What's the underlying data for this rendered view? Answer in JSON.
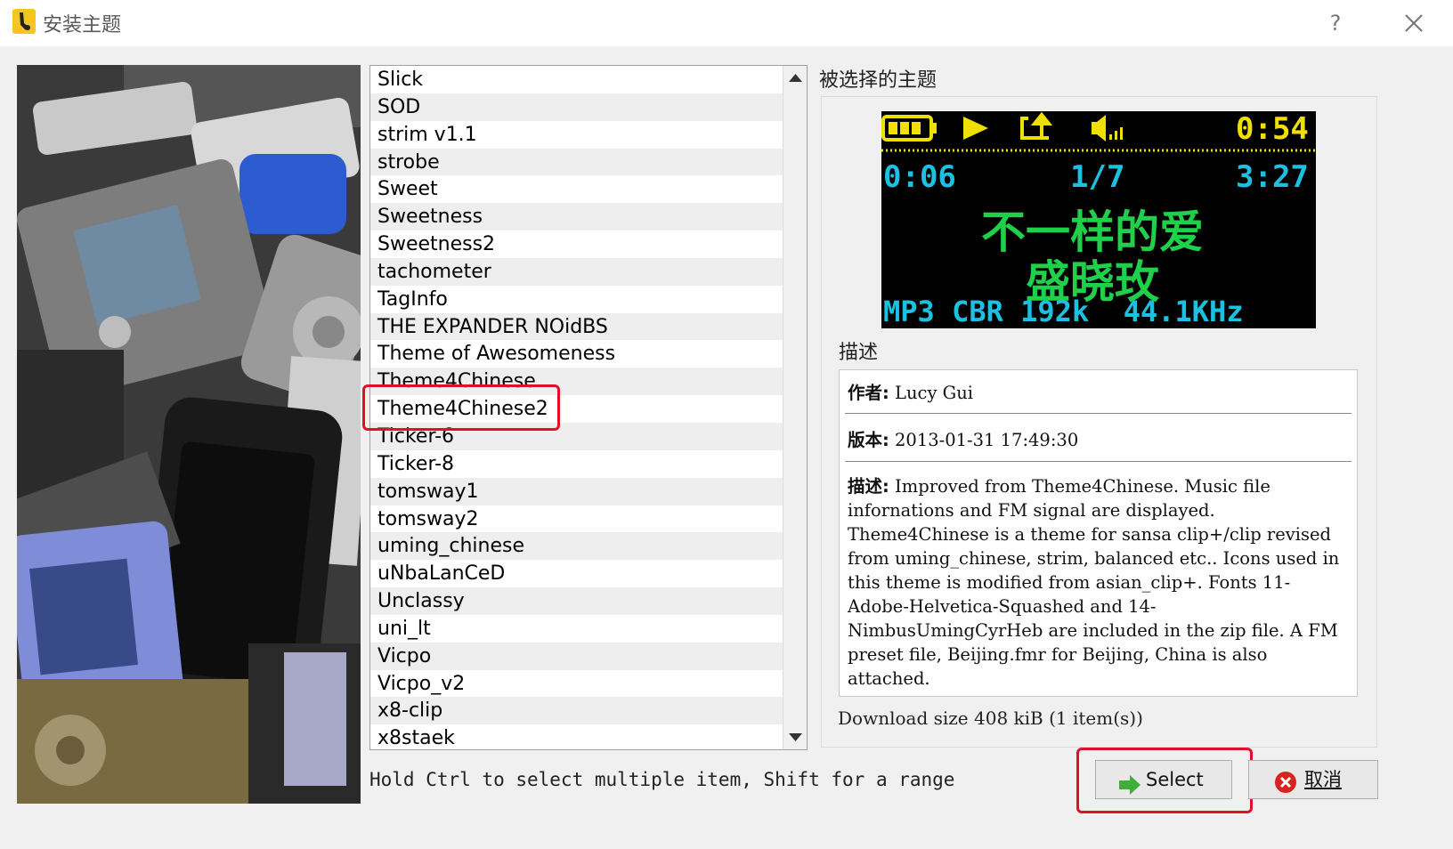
{
  "window": {
    "title": "安装主题",
    "help_glyph": "?",
    "icons": [
      "app-icon",
      "help-icon",
      "close-icon"
    ]
  },
  "theme_list": {
    "items": [
      "Slick",
      "SOD",
      "strim v1.1",
      "strobe",
      "Sweet",
      "Sweetness",
      "Sweetness2",
      "tachometer",
      "TagInfo",
      "THE EXPANDER NOidBS",
      "Theme of Awesomeness",
      "Theme4Chinese",
      "Theme4Chinese2",
      "Ticker-6",
      "Ticker-8",
      "tomsway1",
      "tomsway2",
      "uming_chinese",
      "uNbaLanCeD",
      "Unclassy",
      "uni_lt",
      "Vicpo",
      "Vicpo_v2",
      "x8-clip",
      "x8staek"
    ],
    "selected": "Theme4Chinese2",
    "hint": "Hold Ctrl to select multiple item, Shift for a range"
  },
  "selected_theme": {
    "group_label": "被选择的主题",
    "preview": {
      "time": "0:54",
      "elapsed": "0:06",
      "track": "1/7",
      "total": "3:27",
      "song_title": "不一样的爱",
      "artist": "盛晓玫",
      "codec_line": "MP3 CBR 192k  44.1KHz",
      "accent_color": "#1cc0e0",
      "icons": [
        "battery-icon",
        "play-icon",
        "repeat-icon",
        "volume-icon"
      ]
    },
    "description_label": "描述",
    "author_key": "作者:",
    "author_value": "Lucy Gui",
    "version_key": "版本:",
    "version_value": "2013-01-31 17:49:30",
    "desc_key": "描述:",
    "desc_value": "Improved from Theme4Chinese. Music file infornations and FM signal are displayed. Theme4Chinese is a theme for sansa clip+/clip revised from uming_chinese, strim, balanced etc.. Icons used in this theme is modified from asian_clip+. Fonts 11-Adobe-Helvetica-Squashed and 14-NimbusUmingCyrHeb are included in the zip file. A FM preset file, Beijing.fmr for Beijing, China is also attached.",
    "download_size": "Download size 408 kiB (1 item(s))"
  },
  "buttons": {
    "select_label": "Select",
    "cancel_label": "取消"
  },
  "colors": {
    "highlight": "#e0102a",
    "background": "#f0f0f0"
  }
}
